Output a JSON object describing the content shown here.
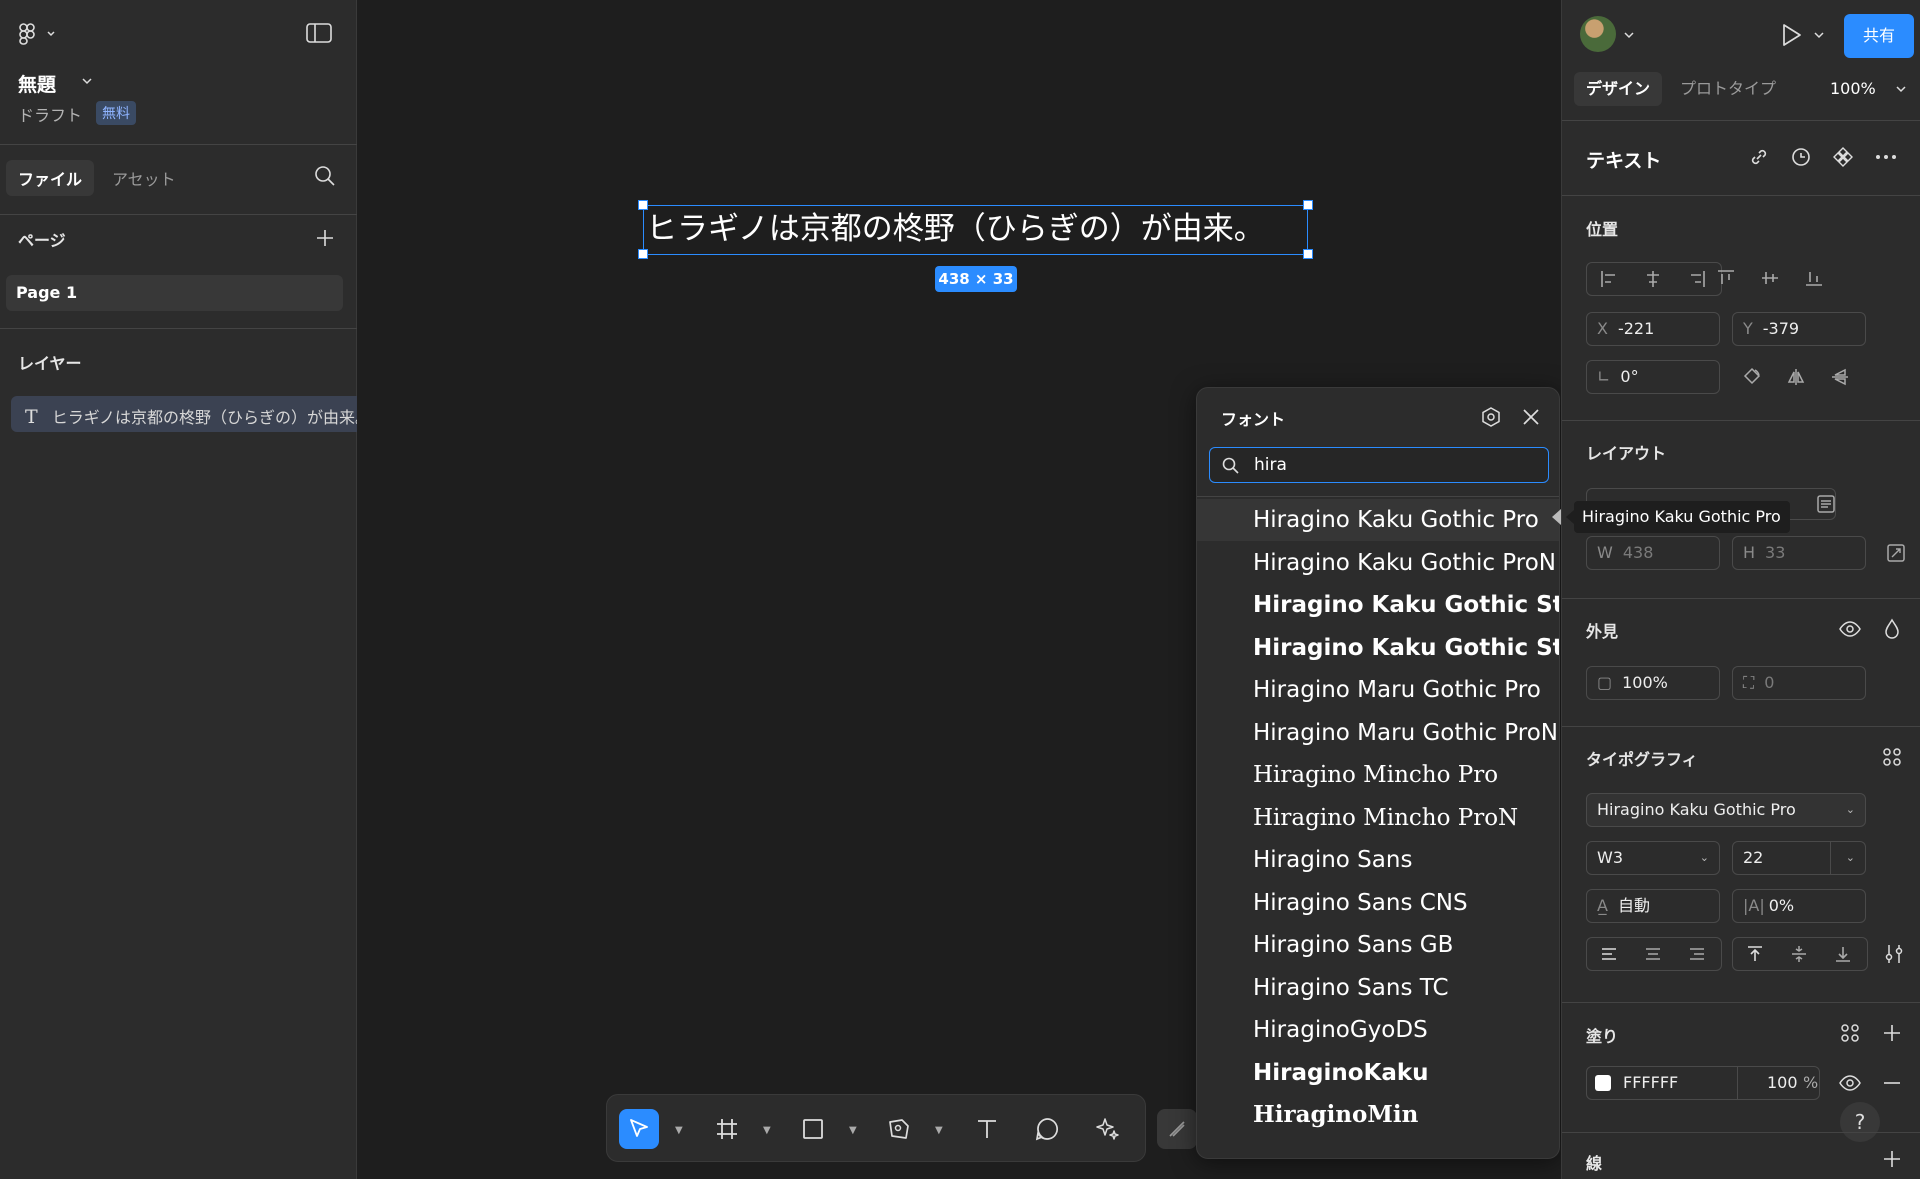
{
  "left_panel": {
    "file_title": "無題",
    "draft_label": "ドラフト",
    "plan_badge": "無料",
    "tabs": [
      {
        "label": "ファイル"
      },
      {
        "label": "アセット"
      }
    ],
    "pages_heading": "ページ",
    "pages": [
      {
        "label": "Page 1"
      }
    ],
    "layers_heading": "レイヤー",
    "layers": [
      {
        "label": "ヒラギノは京都の柊野（ひらぎの）が由来。"
      }
    ]
  },
  "canvas": {
    "text_content": "ヒラギノは京都の柊野（ひらぎの）が由来。",
    "size_badge": "438 × 33"
  },
  "font_popup": {
    "title": "フォント",
    "search_value": "hira",
    "fonts": [
      {
        "label": "Hiragino Kaku Gothic Pro",
        "style": "normal"
      },
      {
        "label": "Hiragino Kaku Gothic ProN",
        "style": "normal"
      },
      {
        "label": "Hiragino Kaku Gothic Std",
        "style": "bold"
      },
      {
        "label": "Hiragino Kaku Gothic StdN",
        "style": "bold"
      },
      {
        "label": "Hiragino Maru Gothic Pro",
        "style": "normal"
      },
      {
        "label": "Hiragino Maru Gothic ProN",
        "style": "normal"
      },
      {
        "label": "Hiragino Mincho Pro",
        "style": "serif"
      },
      {
        "label": "Hiragino Mincho ProN",
        "style": "serif"
      },
      {
        "label": "Hiragino Sans",
        "style": "normal"
      },
      {
        "label": "Hiragino Sans CNS",
        "style": "normal"
      },
      {
        "label": "Hiragino Sans GB",
        "style": "normal"
      },
      {
        "label": "Hiragino Sans TC",
        "style": "normal"
      },
      {
        "label": "HiraginoGyoDS",
        "style": "normal"
      },
      {
        "label": "HiraginoKaku",
        "style": "bold"
      },
      {
        "label": "HiraginoMin",
        "style": "serifbold"
      }
    ]
  },
  "tooltip": "Hiragino Kaku Gothic Pro",
  "right_panel": {
    "share_label": "共有",
    "tabs": [
      {
        "label": "デザイン"
      },
      {
        "label": "プロトタイプ"
      }
    ],
    "zoom": "100%",
    "element_type": "テキスト",
    "position": {
      "heading": "位置",
      "x_label": "X",
      "x_value": "-221",
      "y_label": "Y",
      "y_value": "-379",
      "rotation": "0°"
    },
    "layout": {
      "heading": "レイアウト",
      "w_label": "W",
      "w_value": "438",
      "h_label": "H",
      "h_value": "33"
    },
    "appearance": {
      "heading": "外見",
      "opacity": "100%",
      "radius": "0"
    },
    "typography": {
      "heading": "タイポグラフィ",
      "font_family": "Hiragino Kaku Gothic Pro",
      "weight": "W3",
      "size": "22",
      "line_height": "自動",
      "letter_spacing": "0%"
    },
    "fill": {
      "heading": "塗り",
      "color_hex": "FFFFFF",
      "opacity": "100",
      "percent": "%"
    },
    "stroke": {
      "heading": "線"
    }
  },
  "colors": {
    "accent": "#2b8cff",
    "panel": "#2c2c2c",
    "canvas": "#1e1e1e"
  }
}
